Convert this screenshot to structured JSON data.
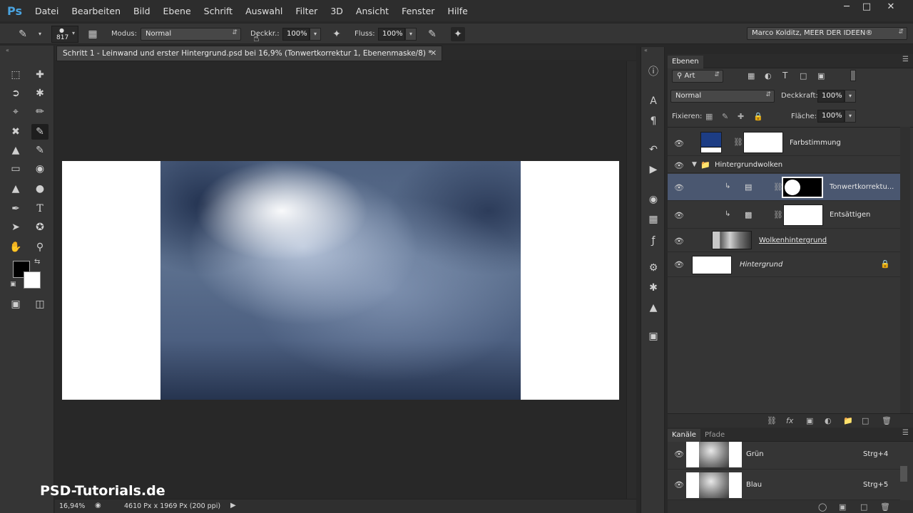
{
  "app": {
    "logo": "Ps"
  },
  "menu": [
    "Datei",
    "Bearbeiten",
    "Bild",
    "Ebene",
    "Schrift",
    "Auswahl",
    "Filter",
    "3D",
    "Ansicht",
    "Fenster",
    "Hilfe"
  ],
  "options": {
    "brush_size": "817",
    "mode_label": "Modus:",
    "mode_value": "Normal",
    "opacity_label": "Deckkr.:",
    "opacity_value": "100%",
    "flow_label": "Fluss:",
    "flow_value": "100%",
    "workspace": "Marco Kolditz, MEER DER IDEEN®"
  },
  "document": {
    "tab_title": "Schritt 1 - Leinwand und erster Hintergrund.psd bei 16,9% (Tonwertkorrektur 1, Ebenenmaske/8) *",
    "zoom": "16,94%",
    "dimensions": "4610 Px x 1969 Px (200 ppi)"
  },
  "watermark": "PSD-Tutorials.de",
  "layers_panel": {
    "tab": "Ebenen",
    "filter_label": "Art",
    "blend_mode": "Normal",
    "opacity_label": "Deckkraft:",
    "opacity_value": "100%",
    "lock_label": "Fixieren:",
    "fill_label": "Fläche:",
    "fill_value": "100%",
    "layers": [
      {
        "name": "Farbstimmung"
      },
      {
        "name": "Hintergrundwolken"
      },
      {
        "name": "Tonwertkorrektu..."
      },
      {
        "name": "Entsättigen"
      },
      {
        "name": "Wolkenhintergrund"
      },
      {
        "name": "Hintergrund"
      }
    ]
  },
  "channels_panel": {
    "tabs": [
      "Kanäle",
      "Pfade"
    ],
    "channels": [
      {
        "name": "Grün",
        "shortcut": "Strg+4"
      },
      {
        "name": "Blau",
        "shortcut": "Strg+5"
      }
    ]
  },
  "colors": {
    "foreground": "#000000",
    "background": "#ffffff",
    "farbstimmung": "#1d3d84",
    "selection": "#4a5770"
  }
}
